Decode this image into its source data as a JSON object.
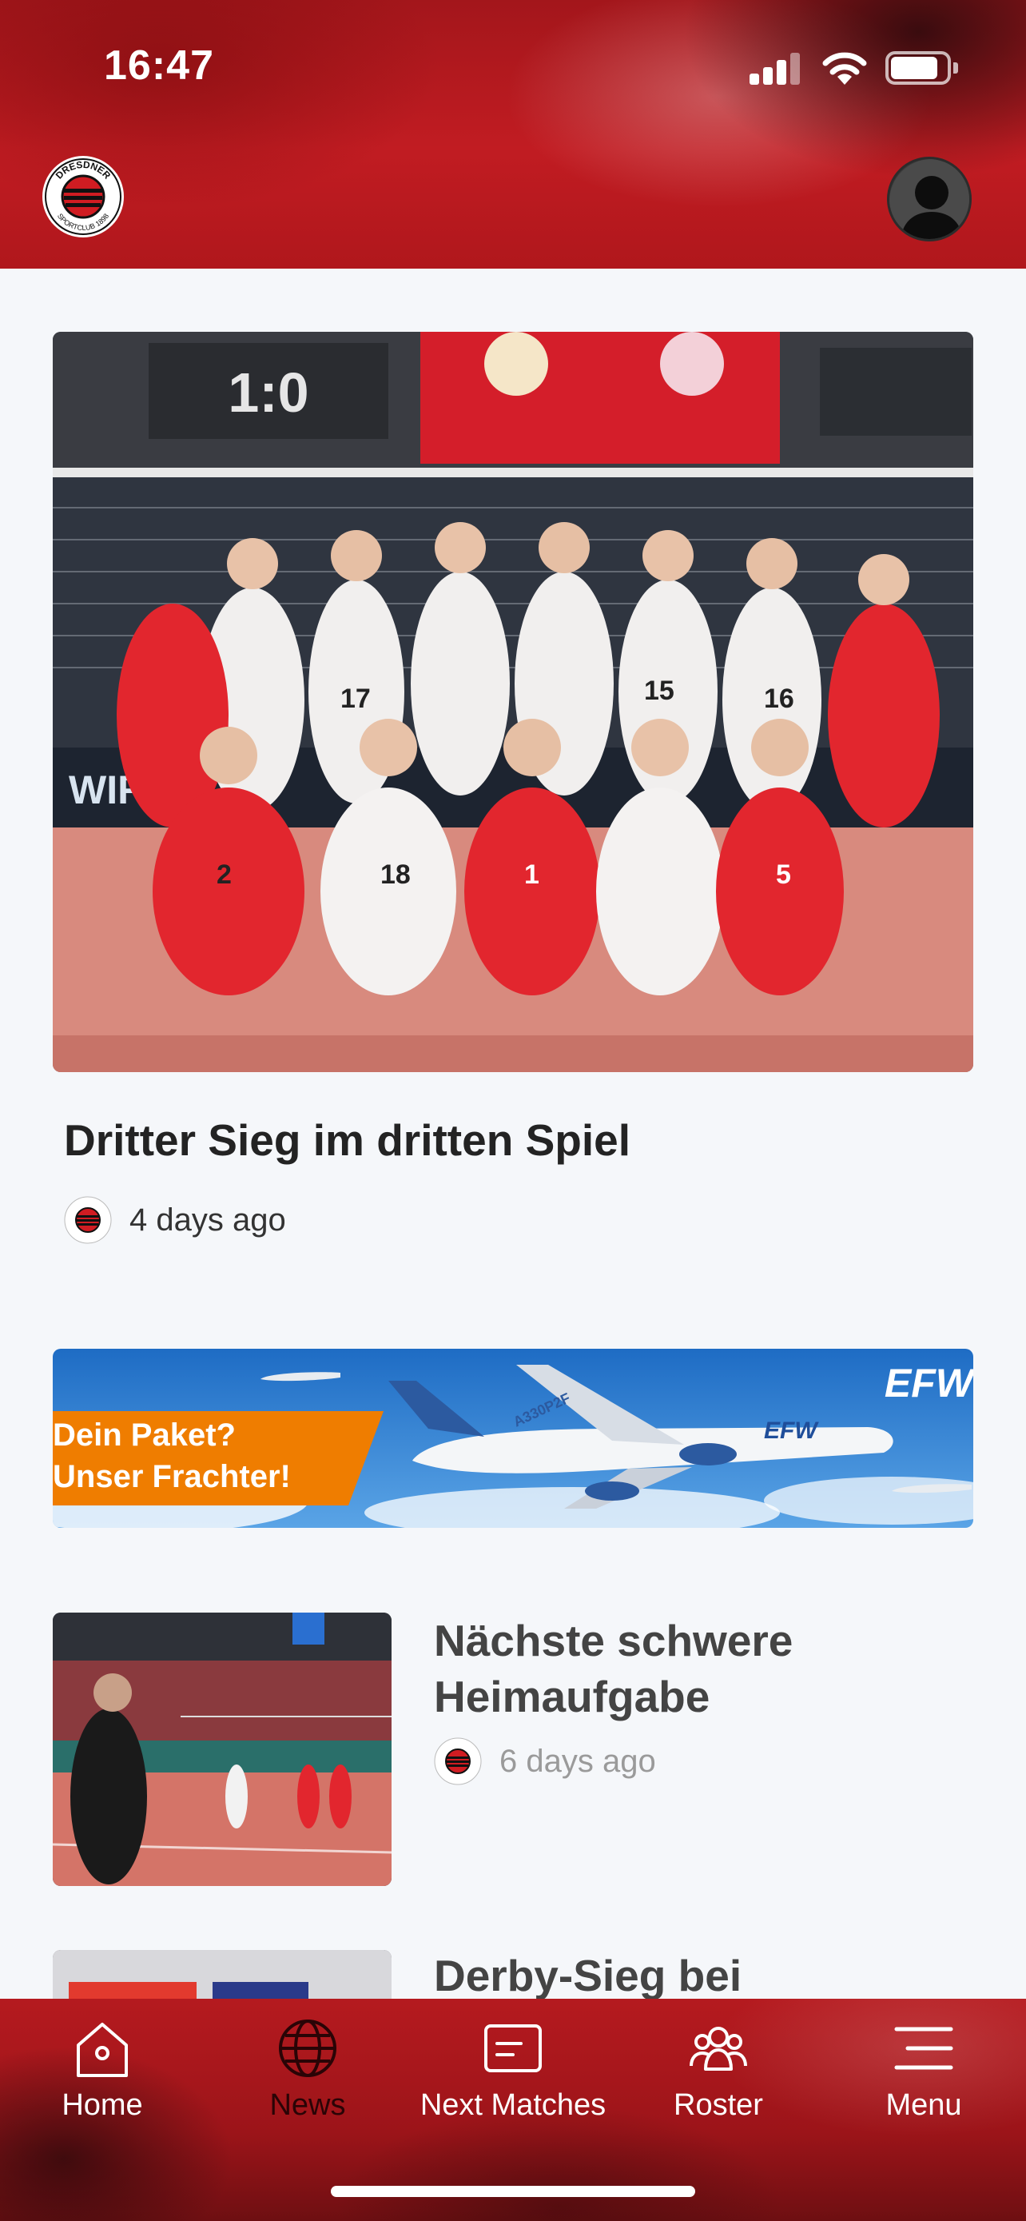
{
  "status_bar": {
    "time": "16:47",
    "icons": [
      "cellular-signal-icon",
      "wifi-icon",
      "battery-icon"
    ]
  },
  "header": {
    "logo_text": "DRESDNER SPORTCLUB 1898",
    "profile_icon": "user-avatar-icon",
    "brand_color": "#c11c22"
  },
  "featured": {
    "image_alt": "Team photo of the volleyball players celebrating",
    "scoreboard": "1:0",
    "title": "Dritter Sieg im dritten Spiel",
    "time_ago": "4 days ago"
  },
  "ad": {
    "line1": "Dein Paket?",
    "line2": "Unser Frachter!",
    "brand": "EFW",
    "aircraft_label": "A330P2F",
    "colors": {
      "sky": "#2f7fd0",
      "orange": "#ef7d00"
    }
  },
  "articles": [
    {
      "title": "Nächste schwere Heimaufgabe",
      "time_ago": "6 days ago"
    },
    {
      "title": "Derby-Sieg bei",
      "time_ago": ""
    }
  ],
  "bottom_nav": {
    "items": [
      {
        "label": "Home",
        "icon": "home-icon",
        "active": true
      },
      {
        "label": "News",
        "icon": "globe-icon",
        "active": false
      },
      {
        "label": "Next Matches",
        "icon": "calendar-card-icon",
        "active": true
      },
      {
        "label": "Roster",
        "icon": "team-icon",
        "active": true
      },
      {
        "label": "Menu",
        "icon": "hamburger-menu-icon",
        "active": true
      }
    ]
  }
}
